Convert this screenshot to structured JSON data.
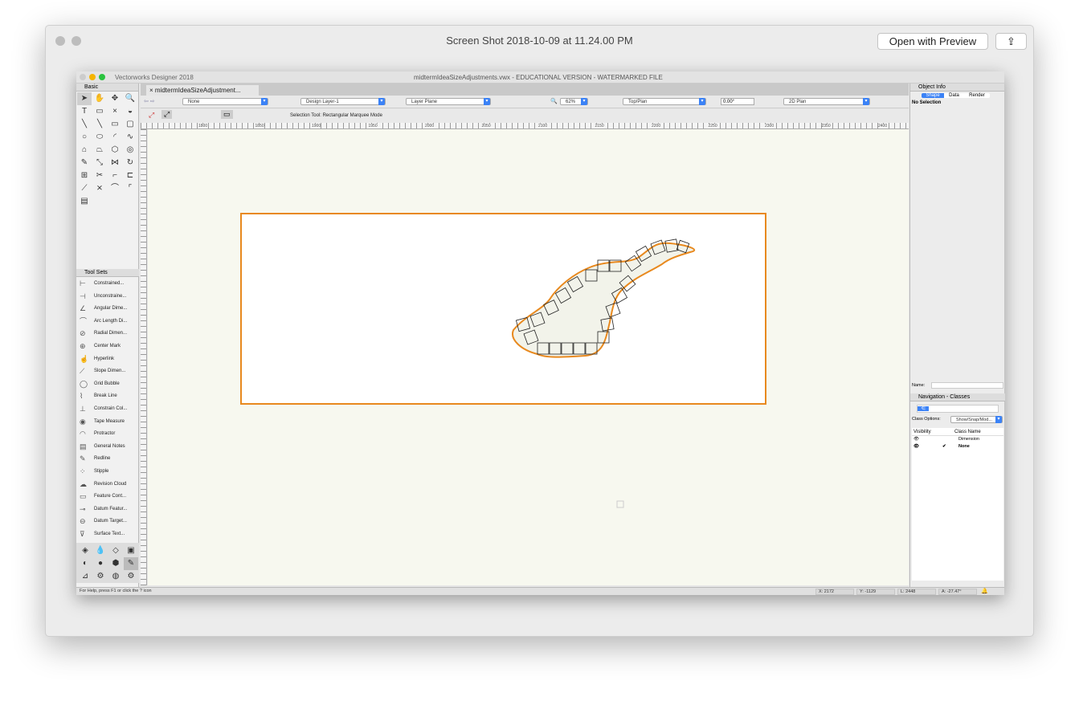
{
  "preview": {
    "title": "Screen Shot 2018-10-09 at 11.24.00 PM",
    "open_with": "Open with Preview",
    "share_icon": "share-icon"
  },
  "app": {
    "name": "Vectorworks Designer 2018",
    "document_title": "midtermIdeaSizeAdjustments.vwx - EDUCATIONAL VERSION - WATERMARKED FILE",
    "tab": "midtermIdeaSizeAdjustment..."
  },
  "view_bar": {
    "class": "None",
    "layer": "Design Layer-1",
    "plane": "Layer Plane",
    "zoom": "62%",
    "view": "Top/Plan",
    "rotation": "0.00°",
    "render": "2D Plan"
  },
  "mode_bar": {
    "message": "Selection Tool: Rectangular Marquee Mode"
  },
  "ruler": {
    "labels": [
      "1800",
      "1850",
      "1900",
      "1950",
      "2000",
      "2050",
      "2100",
      "2150",
      "2200",
      "2250",
      "2300",
      "2350",
      "2400"
    ]
  },
  "basic": {
    "title": "Basic"
  },
  "tool_sets": {
    "title": "Tool Sets",
    "items": [
      "Constrained...",
      "Unconstraine...",
      "Angular Dime...",
      "Arc Length Di...",
      "Radial Dimen...",
      "Center Mark",
      "Hyperlink",
      "Slope Dimen...",
      "Grid Bubble",
      "Break Line",
      "Constrain Col...",
      "Tape Measure",
      "Protractor",
      "General Notes",
      "Redline",
      "Stipple",
      "Revision Cloud",
      "Feature Cont...",
      "Datum Featur...",
      "Datum Target...",
      "Surface Text..."
    ]
  },
  "object_info": {
    "title": "Object Info",
    "tabs": [
      "Shape",
      "Data",
      "Render"
    ],
    "active_tab": "Shape",
    "selection": "No Selection",
    "name_label": "Name:",
    "name_value": ""
  },
  "navigation": {
    "title": "Navigation - Classes",
    "class_options_label": "Class Options:",
    "class_options_value": "Show/Snap/Mod...",
    "columns": [
      "Visibility",
      "Class Name"
    ],
    "rows": [
      {
        "name": "Dimension",
        "active": false
      },
      {
        "name": "None",
        "active": true
      }
    ]
  },
  "status": {
    "help": "For Help, press F1 or click the ? icon",
    "x": "X: 2172",
    "y": "Y: -1129",
    "l": "L: 2448",
    "a": "A: -27.47°"
  },
  "colors": {
    "accent": "#3b82f6",
    "selection": "#e8891e",
    "canvas": "#f7f8ef"
  }
}
